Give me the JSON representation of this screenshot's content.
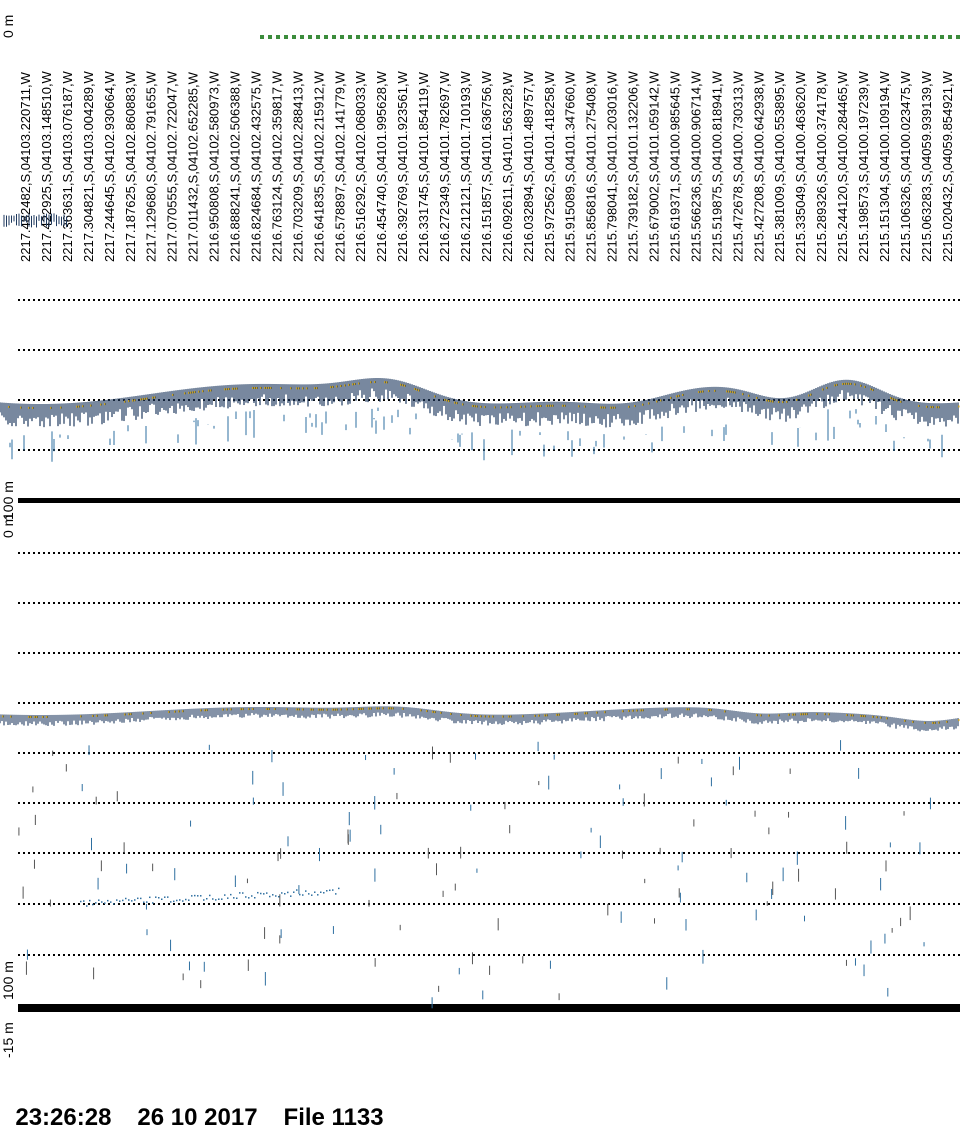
{
  "header": {
    "coords": [
      "2217.482482,S,04103.220711,W",
      "2217.422925,S,04103.148510,W",
      "2217.363631,S,04103.076187,W",
      "2217.304821,S,04103.004289,W",
      "2217.244645,S,04102.930664,W",
      "2217.187625,S,04102.860883,W",
      "2217.129680,S,04102.791655,W",
      "2217.070555,S,04102.722047,W",
      "2217.011432,S,04102.652285,W",
      "2216.950808,S,04102.580973,W",
      "2216.888241,S,04102.506388,W",
      "2216.824684,S,04102.432575,W",
      "2216.763124,S,04102.359817,W",
      "2216.703209,S,04102.288413,W",
      "2216.641835,S,04102.215912,W",
      "2216.578897,S,04102.141779,W",
      "2216.516292,S,04102.068033,W",
      "2216.454740,S,04101.995628,W",
      "2216.392769,S,04101.923561,W",
      "2216.331745,S,04101.854119,W",
      "2216.272349,S,04101.782697,W",
      "2216.212121,S,04101.710193,W",
      "2216.151857,S,04101.636756,W",
      "2216.092611,S,04101.563228,W",
      "2216.032894,S,04101.489757,W",
      "2215.972562,S,04101.418258,W",
      "2215.915089,S,04101.347660,W",
      "2215.856816,S,04101.275408,W",
      "2215.798041,S,04101.203016,W",
      "2215.739182,S,04101.132206,W",
      "2215.679002,S,04101.059142,W",
      "2215.619371,S,04100.985645,W",
      "2215.566236,S,04100.906714,W",
      "2215.519875,S,04100.818941,W",
      "2215.472678,S,04100.730313,W",
      "2215.427208,S,04100.642938,W",
      "2215.381009,S,04100.553895,W",
      "2215.335049,S,04100.463620,W",
      "2215.289326,S,04100.374178,W",
      "2215.244120,S,04100.284465,W",
      "2215.198573,S,04100.197239,W",
      "2215.151304,S,04100.109194,W",
      "2215.106326,S,04100.023475,W",
      "2215.063283,S,04059.939139,W",
      "2215.020432,S,04059.854921,W"
    ]
  },
  "panel_top": {
    "depth_top": "0 m",
    "depth_bottom": "100 m"
  },
  "panel_bottom": {
    "depth_top": "0 m",
    "depth_bottom": "100 m"
  },
  "offset_label": "-15 m",
  "footer": {
    "time": "23:26:28",
    "date": "26 10 2017",
    "file": "File 1133"
  },
  "colors": {
    "echo_dark": "#1f3a5f",
    "echo_light": "#2e6fa0",
    "echo_gold": "#c9a227",
    "echo_green": "#3c8c3c",
    "grid": "#000000"
  }
}
